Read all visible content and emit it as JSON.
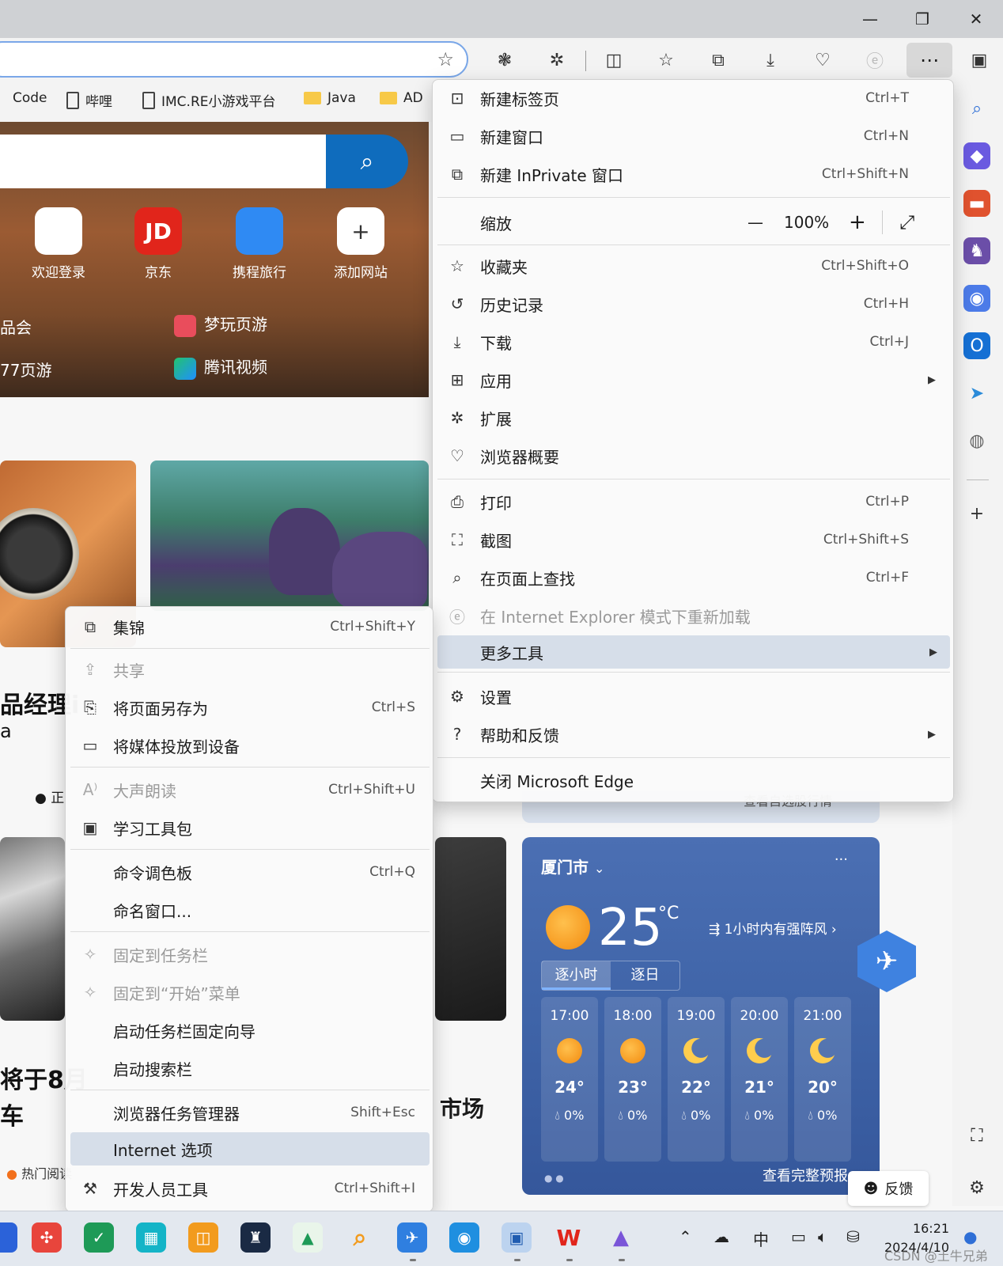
{
  "window": {
    "minimize": "—",
    "restore": "❐",
    "close": "✕"
  },
  "toolbar": {
    "more": "⋯"
  },
  "favorites": [
    "Code",
    "哔哩",
    "IMC.RE小游戏平台",
    "Java",
    "AD"
  ],
  "page": {
    "tiles": [
      {
        "label": "欢迎登录",
        "logo": ""
      },
      {
        "label": "京东",
        "logo": "JD"
      },
      {
        "label": "携程旅行",
        "logo": ""
      },
      {
        "label": "添加网站",
        "logo": "+"
      }
    ],
    "links": [
      "品会",
      "梦玩页游",
      "77页游",
      "腾讯视频"
    ],
    "news": [
      "品经理i",
      "a",
      "将于8月",
      "车"
    ],
    "badge": "正",
    "hot": "热门阅读",
    "market": "市场",
    "partial": "查看自选股行情"
  },
  "weather": {
    "city": "厦门市",
    "menu": "···",
    "temp": "25",
    "unit": "°C",
    "wind": "1小时内有强阵风",
    "tabs": [
      "逐小时",
      "逐日"
    ],
    "hours": [
      {
        "time": "17:00",
        "temp": "24°",
        "rain": "0%",
        "icon": "sun"
      },
      {
        "time": "18:00",
        "temp": "23°",
        "rain": "0%",
        "icon": "sun"
      },
      {
        "time": "19:00",
        "temp": "22°",
        "rain": "0%",
        "icon": "moon"
      },
      {
        "time": "20:00",
        "temp": "21°",
        "rain": "0%",
        "icon": "moon"
      },
      {
        "time": "21:00",
        "temp": "20°",
        "rain": "0%",
        "icon": "moon"
      }
    ],
    "full": "查看完整预报"
  },
  "feedback": "反馈",
  "menu": {
    "items": [
      {
        "label": "新建标签页",
        "shortcut": "Ctrl+T",
        "icon": "new-tab-icon"
      },
      {
        "label": "新建窗口",
        "shortcut": "Ctrl+N",
        "icon": "new-window-icon"
      },
      {
        "label": "新建 InPrivate 窗口",
        "shortcut": "Ctrl+Shift+N",
        "icon": "inprivate-icon"
      },
      {
        "label": "收藏夹",
        "shortcut": "Ctrl+Shift+O",
        "icon": "favorites-icon"
      },
      {
        "label": "历史记录",
        "shortcut": "Ctrl+H",
        "icon": "history-icon"
      },
      {
        "label": "下载",
        "shortcut": "Ctrl+J",
        "icon": "download-icon"
      },
      {
        "label": "应用",
        "shortcut": "",
        "icon": "apps-icon"
      },
      {
        "label": "扩展",
        "shortcut": "",
        "icon": "extensions-icon"
      },
      {
        "label": "浏览器概要",
        "shortcut": "",
        "icon": "browser-essentials-icon"
      },
      {
        "label": "打印",
        "shortcut": "Ctrl+P",
        "icon": "print-icon"
      },
      {
        "label": "截图",
        "shortcut": "Ctrl+Shift+S",
        "icon": "screenshot-icon"
      },
      {
        "label": "在页面上查找",
        "shortcut": "Ctrl+F",
        "icon": "find-icon"
      },
      {
        "label": "在 Internet Explorer 模式下重新加载",
        "shortcut": "",
        "icon": "ie-mode-icon"
      },
      {
        "label": "更多工具",
        "shortcut": "",
        "icon": ""
      },
      {
        "label": "设置",
        "shortcut": "",
        "icon": "settings-icon"
      },
      {
        "label": "帮助和反馈",
        "shortcut": "",
        "icon": "help-icon"
      },
      {
        "label": "关闭 Microsoft Edge",
        "shortcut": "",
        "icon": ""
      }
    ],
    "zoom": {
      "label": "缩放",
      "minus": "—",
      "value": "100%",
      "plus": "+",
      "expand": "⤢"
    }
  },
  "submenu": {
    "items": [
      {
        "label": "集锦",
        "shortcut": "Ctrl+Shift+Y"
      },
      {
        "label": "共享",
        "shortcut": ""
      },
      {
        "label": "将页面另存为",
        "shortcut": "Ctrl+S"
      },
      {
        "label": "将媒体投放到设备",
        "shortcut": ""
      },
      {
        "label": "大声朗读",
        "shortcut": "Ctrl+Shift+U"
      },
      {
        "label": "学习工具包",
        "shortcut": ""
      },
      {
        "label": "命令调色板",
        "shortcut": "Ctrl+Q"
      },
      {
        "label": "命名窗口...",
        "shortcut": ""
      },
      {
        "label": "固定到任务栏",
        "shortcut": ""
      },
      {
        "label": "固定到“开始”菜单",
        "shortcut": ""
      },
      {
        "label": "启动任务栏固定向导",
        "shortcut": ""
      },
      {
        "label": "启动搜索栏",
        "shortcut": ""
      },
      {
        "label": "浏览器任务管理器",
        "shortcut": "Shift+Esc"
      },
      {
        "label": "Internet 选项",
        "shortcut": ""
      },
      {
        "label": "开发人员工具",
        "shortcut": "Ctrl+Shift+I"
      }
    ]
  },
  "taskbar": {
    "ime": "中",
    "time": "16:21",
    "date": "2024/4/10"
  },
  "watermark": "CSDN @土牛兄弟"
}
